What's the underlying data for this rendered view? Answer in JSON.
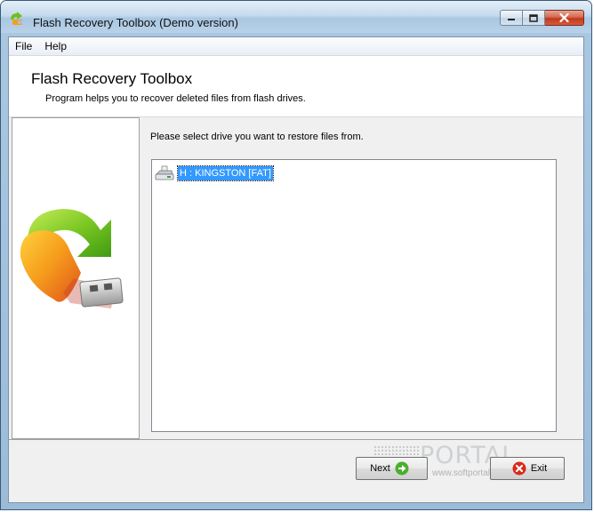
{
  "window": {
    "title": "Flash Recovery Toolbox (Demo version)"
  },
  "menu": {
    "items": [
      "File",
      "Help"
    ]
  },
  "header": {
    "title": "Flash Recovery Toolbox",
    "subtitle": "Program helps you to recover deleted files from flash drives."
  },
  "main": {
    "instruction": "Please select drive you want to restore files from.",
    "drives": [
      {
        "label": "H : KINGSTON [FAT]",
        "selected": true,
        "icon": "removable-drive-icon"
      }
    ]
  },
  "buttons": {
    "next_label": "Next",
    "exit_label": "Exit"
  },
  "watermark": {
    "text": "PORTAL",
    "url": "www.softportal.com"
  },
  "colors": {
    "selection": "#3399ff",
    "logo_arrow": "#6fbf1f",
    "logo_body": "#f0a020"
  }
}
